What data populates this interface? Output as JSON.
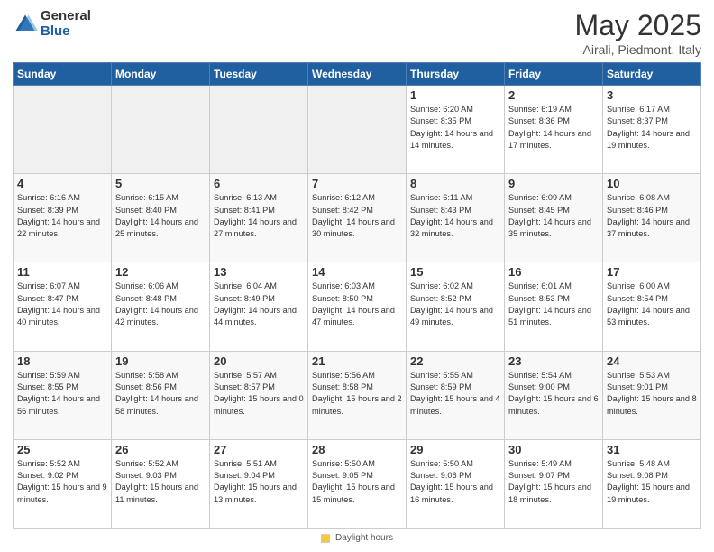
{
  "logo": {
    "general": "General",
    "blue": "Blue"
  },
  "title": "May 2025",
  "subtitle": "Airali, Piedmont, Italy",
  "days_header": [
    "Sunday",
    "Monday",
    "Tuesday",
    "Wednesday",
    "Thursday",
    "Friday",
    "Saturday"
  ],
  "weeks": [
    [
      {
        "day": "",
        "info": ""
      },
      {
        "day": "",
        "info": ""
      },
      {
        "day": "",
        "info": ""
      },
      {
        "day": "",
        "info": ""
      },
      {
        "day": "1",
        "info": "Sunrise: 6:20 AM\nSunset: 8:35 PM\nDaylight: 14 hours\nand 14 minutes."
      },
      {
        "day": "2",
        "info": "Sunrise: 6:19 AM\nSunset: 8:36 PM\nDaylight: 14 hours\nand 17 minutes."
      },
      {
        "day": "3",
        "info": "Sunrise: 6:17 AM\nSunset: 8:37 PM\nDaylight: 14 hours\nand 19 minutes."
      }
    ],
    [
      {
        "day": "4",
        "info": "Sunrise: 6:16 AM\nSunset: 8:39 PM\nDaylight: 14 hours\nand 22 minutes."
      },
      {
        "day": "5",
        "info": "Sunrise: 6:15 AM\nSunset: 8:40 PM\nDaylight: 14 hours\nand 25 minutes."
      },
      {
        "day": "6",
        "info": "Sunrise: 6:13 AM\nSunset: 8:41 PM\nDaylight: 14 hours\nand 27 minutes."
      },
      {
        "day": "7",
        "info": "Sunrise: 6:12 AM\nSunset: 8:42 PM\nDaylight: 14 hours\nand 30 minutes."
      },
      {
        "day": "8",
        "info": "Sunrise: 6:11 AM\nSunset: 8:43 PM\nDaylight: 14 hours\nand 32 minutes."
      },
      {
        "day": "9",
        "info": "Sunrise: 6:09 AM\nSunset: 8:45 PM\nDaylight: 14 hours\nand 35 minutes."
      },
      {
        "day": "10",
        "info": "Sunrise: 6:08 AM\nSunset: 8:46 PM\nDaylight: 14 hours\nand 37 minutes."
      }
    ],
    [
      {
        "day": "11",
        "info": "Sunrise: 6:07 AM\nSunset: 8:47 PM\nDaylight: 14 hours\nand 40 minutes."
      },
      {
        "day": "12",
        "info": "Sunrise: 6:06 AM\nSunset: 8:48 PM\nDaylight: 14 hours\nand 42 minutes."
      },
      {
        "day": "13",
        "info": "Sunrise: 6:04 AM\nSunset: 8:49 PM\nDaylight: 14 hours\nand 44 minutes."
      },
      {
        "day": "14",
        "info": "Sunrise: 6:03 AM\nSunset: 8:50 PM\nDaylight: 14 hours\nand 47 minutes."
      },
      {
        "day": "15",
        "info": "Sunrise: 6:02 AM\nSunset: 8:52 PM\nDaylight: 14 hours\nand 49 minutes."
      },
      {
        "day": "16",
        "info": "Sunrise: 6:01 AM\nSunset: 8:53 PM\nDaylight: 14 hours\nand 51 minutes."
      },
      {
        "day": "17",
        "info": "Sunrise: 6:00 AM\nSunset: 8:54 PM\nDaylight: 14 hours\nand 53 minutes."
      }
    ],
    [
      {
        "day": "18",
        "info": "Sunrise: 5:59 AM\nSunset: 8:55 PM\nDaylight: 14 hours\nand 56 minutes."
      },
      {
        "day": "19",
        "info": "Sunrise: 5:58 AM\nSunset: 8:56 PM\nDaylight: 14 hours\nand 58 minutes."
      },
      {
        "day": "20",
        "info": "Sunrise: 5:57 AM\nSunset: 8:57 PM\nDaylight: 15 hours\nand 0 minutes."
      },
      {
        "day": "21",
        "info": "Sunrise: 5:56 AM\nSunset: 8:58 PM\nDaylight: 15 hours\nand 2 minutes."
      },
      {
        "day": "22",
        "info": "Sunrise: 5:55 AM\nSunset: 8:59 PM\nDaylight: 15 hours\nand 4 minutes."
      },
      {
        "day": "23",
        "info": "Sunrise: 5:54 AM\nSunset: 9:00 PM\nDaylight: 15 hours\nand 6 minutes."
      },
      {
        "day": "24",
        "info": "Sunrise: 5:53 AM\nSunset: 9:01 PM\nDaylight: 15 hours\nand 8 minutes."
      }
    ],
    [
      {
        "day": "25",
        "info": "Sunrise: 5:52 AM\nSunset: 9:02 PM\nDaylight: 15 hours\nand 9 minutes."
      },
      {
        "day": "26",
        "info": "Sunrise: 5:52 AM\nSunset: 9:03 PM\nDaylight: 15 hours\nand 11 minutes."
      },
      {
        "day": "27",
        "info": "Sunrise: 5:51 AM\nSunset: 9:04 PM\nDaylight: 15 hours\nand 13 minutes."
      },
      {
        "day": "28",
        "info": "Sunrise: 5:50 AM\nSunset: 9:05 PM\nDaylight: 15 hours\nand 15 minutes."
      },
      {
        "day": "29",
        "info": "Sunrise: 5:50 AM\nSunset: 9:06 PM\nDaylight: 15 hours\nand 16 minutes."
      },
      {
        "day": "30",
        "info": "Sunrise: 5:49 AM\nSunset: 9:07 PM\nDaylight: 15 hours\nand 18 minutes."
      },
      {
        "day": "31",
        "info": "Sunrise: 5:48 AM\nSunset: 9:08 PM\nDaylight: 15 hours\nand 19 minutes."
      }
    ]
  ],
  "footer": {
    "dot_label": "Daylight hours"
  }
}
